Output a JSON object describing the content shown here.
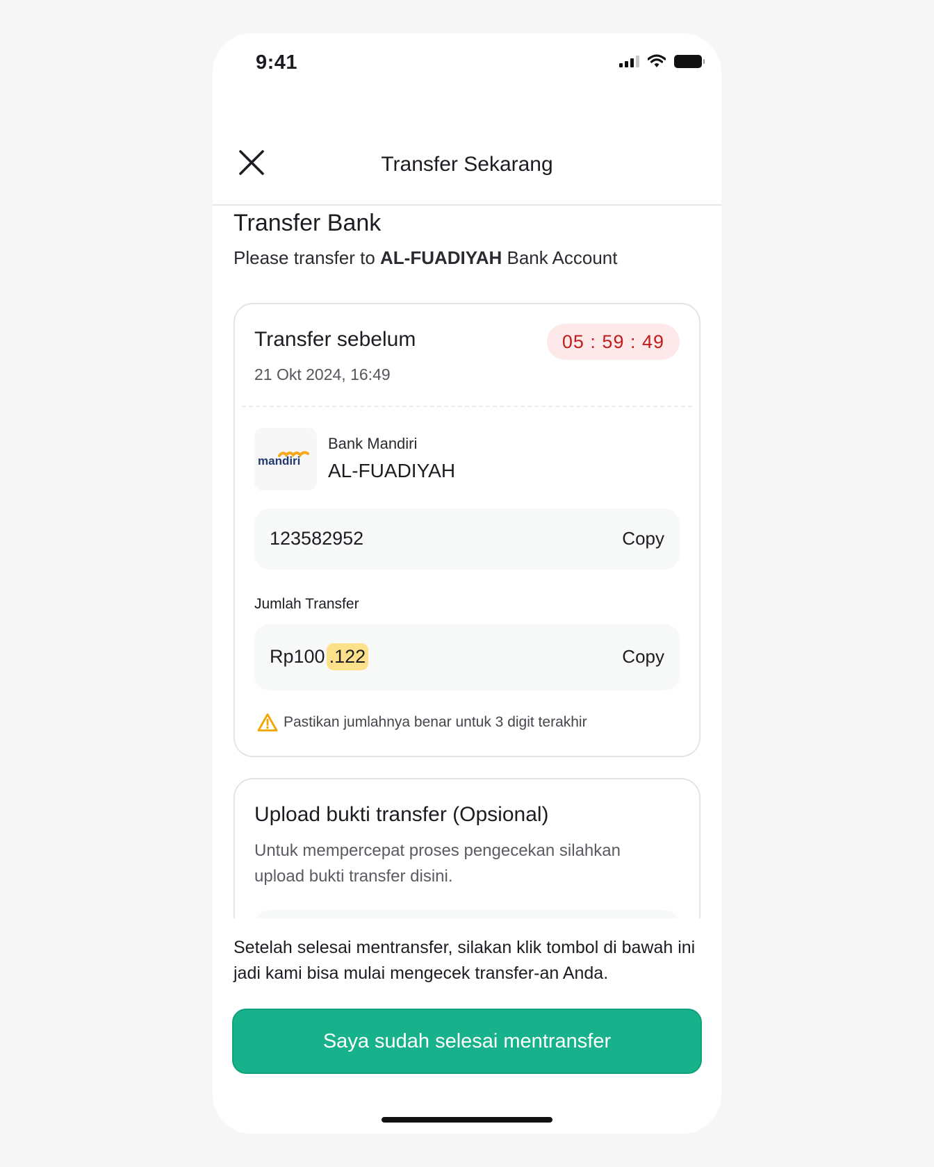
{
  "status_bar": {
    "time": "9:41"
  },
  "header": {
    "title": "Transfer Sekarang"
  },
  "transfer_section": {
    "title": "Transfer Bank",
    "subtitle_prefix": "Please transfer to ",
    "subtitle_account": "AL-FUADIYAH",
    "subtitle_suffix": " Bank Account"
  },
  "payment_card": {
    "deadline_label": "Transfer sebelum",
    "deadline_date": "21 Okt 2024, 16:49",
    "countdown": "05 : 59 : 49",
    "bank_name": "Bank Mandiri",
    "account_holder": "AL-FUADIYAH",
    "bank_logo_text": "mandiri",
    "account_number": "123582952",
    "copy_label": "Copy",
    "amount_label": "Jumlah Transfer",
    "amount_main": "Rp100",
    "amount_unique": ".122",
    "warning_text": "Pastikan jumlahnya benar untuk 3 digit terakhir"
  },
  "upload_card": {
    "title": "Upload bukti transfer (Opsional)",
    "description": "Untuk mempercepat proses pengecekan silahkan upload bukti transfer disini."
  },
  "footer": {
    "info": "Setelah selesai mentransfer, silakan klik tombol di bawah ini jadi kami bisa mulai mengecek transfer-an Anda.",
    "confirm_button": "Saya sudah selesai mentransfer"
  },
  "colors": {
    "primary": "#17b28c",
    "timer_text": "#c11d1d",
    "timer_bg": "#fde9e9",
    "highlight": "#fce08a",
    "warning": "#f0a500"
  },
  "icons": {
    "close": "close-icon",
    "warning": "warning-icon",
    "signal": "signal-icon",
    "wifi": "wifi-icon",
    "battery": "battery-icon"
  }
}
